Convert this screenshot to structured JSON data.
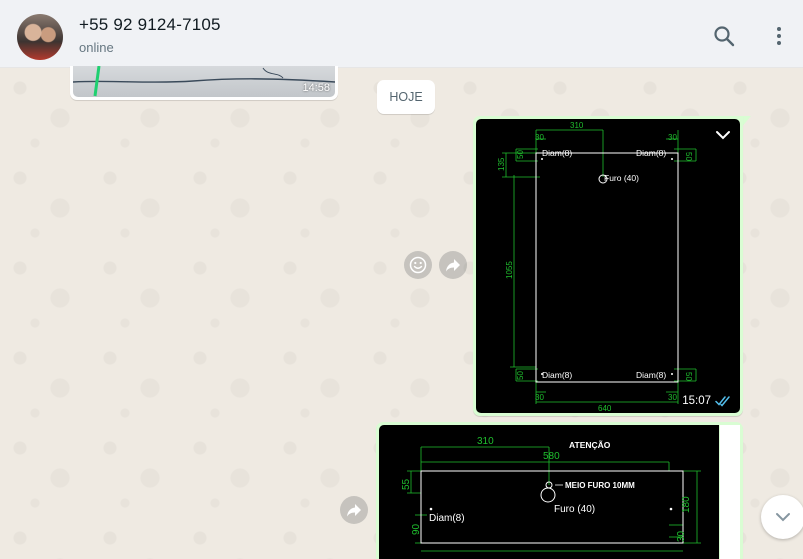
{
  "header": {
    "contact_name": "+55 92 9124-7105",
    "status": "online",
    "search_icon": "search-icon",
    "menu_icon": "kebab-menu-icon"
  },
  "messages": {
    "previous_time": "14:58",
    "date_chip": "HOJE",
    "drawing1": {
      "time": "15:07",
      "receipt": "double-check-read",
      "labels": {
        "top_width": "310",
        "top_left_offset": "30",
        "top_right_offset": "30",
        "left_135": "135",
        "left_50_top": "50",
        "right_50_top": "50",
        "diam_tl": "Diam(8)",
        "diam_tr": "Diam(8)",
        "furo": "Furo (40)",
        "height": "1055",
        "diam_bl": "Diam(8)",
        "diam_br": "Diam(8)",
        "left_50_bottom": "50",
        "right_50_bottom": "50",
        "bottom_left_offset": "30",
        "bottom_right_offset": "30",
        "bottom_width": "640"
      }
    },
    "drawing2": {
      "labels": {
        "width_310": "310",
        "attention": "ATENÇÃO",
        "width_580": "580",
        "left_55": "55",
        "meio_furo": "MEIO FURO 10MM",
        "furo": "Furo (40)",
        "diam": "Diam(8)",
        "right_180": "180",
        "left_90": "90",
        "right_30": "30"
      }
    }
  },
  "colors": {
    "header_bg": "#f0f2f5",
    "chat_bg": "#efeae2",
    "outgoing_bubble": "#d9fdd3",
    "read_tick": "#53bdeb",
    "dimension_green": "#1fbf2e"
  },
  "icons": {
    "emoji": "smiley-icon",
    "forward": "forward-icon",
    "scroll": "chevron-down-icon"
  }
}
